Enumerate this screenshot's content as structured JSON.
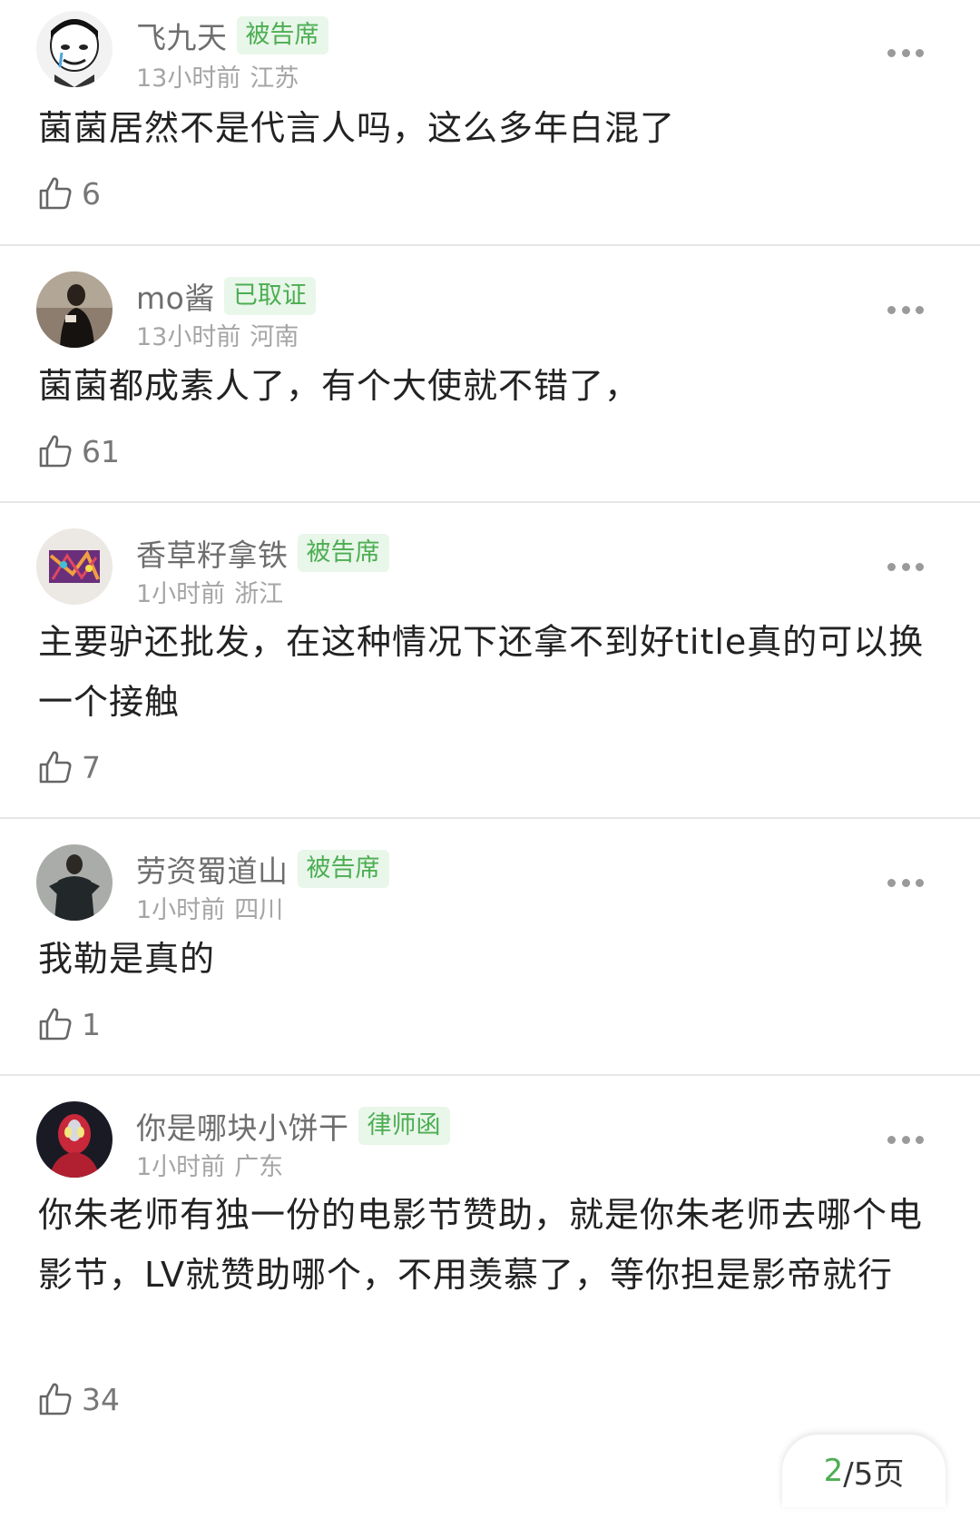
{
  "comments": [
    {
      "username": "飞九天",
      "badge": "被告席",
      "time": "13小时前",
      "location": "江苏",
      "text": "菌菌居然不是代言人吗，这么多年白混了",
      "likes": "6",
      "avatar_icon": "meme-face-avatar"
    },
    {
      "username": "mo酱",
      "badge": "已取证",
      "time": "13小时前",
      "location": "河南",
      "text": "菌菌都成素人了，有个大使就不错了，",
      "likes": "61",
      "avatar_icon": "woman-photo-avatar"
    },
    {
      "username": "香草籽拿铁",
      "badge": "被告席",
      "time": "1小时前",
      "location": "浙江",
      "text": "主要驴还批发，在这种情况下还拿不到好title真的可以换一个接触",
      "likes": "7",
      "avatar_icon": "abstract-painting-avatar"
    },
    {
      "username": "劳资蜀道山",
      "badge": "被告席",
      "time": "1小时前",
      "location": "四川",
      "text": "我勒是真的",
      "likes": "1",
      "avatar_icon": "man-in-suit-avatar"
    },
    {
      "username": "你是哪块小饼干",
      "badge": "律师函",
      "time": "1小时前",
      "location": "广东",
      "text": "你朱老师有独一份的电影节赞助，就是你朱老师去哪个电影节，LV就赞助哪个，不用羡慕了，等你担是影帝就行",
      "likes": "34",
      "avatar_icon": "ultraman-avatar"
    }
  ],
  "pager": {
    "current": "2",
    "rest": "/5页"
  },
  "colors": {
    "badge_text": "#4cae52",
    "badge_bg": "#e9f6ea",
    "username": "#6e6e6e",
    "meta": "#a5a5a5"
  }
}
